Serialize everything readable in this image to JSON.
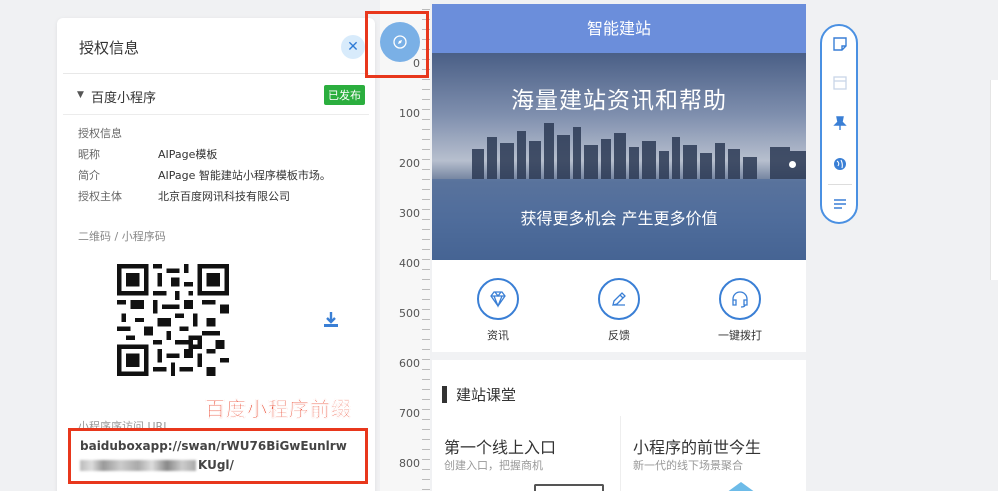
{
  "auth_panel": {
    "title": "授权信息",
    "close_icon": "close-icon",
    "section": {
      "name": "百度小程序",
      "badge": "已发布"
    },
    "info_heading": "授权信息",
    "fields": [
      {
        "label": "昵称",
        "value": "AIPage模板"
      },
      {
        "label": "简介",
        "value": "AIPage 智能建站小程序模板市场。"
      },
      {
        "label": "授权主体",
        "value": "北京百度网讯科技有限公司"
      }
    ],
    "qr_label": "二维码 / 小程序码",
    "download_icon": "download-icon",
    "url_label": "小程序序访问 URL",
    "url_line1": "baiduboxapp://swan/rWU76BiGwEunlrw",
    "url_line2_suffix": "KUgl/"
  },
  "annotation": "百度小程序前缀",
  "ruler": {
    "marks": [
      "0",
      "100",
      "200",
      "300",
      "400",
      "500",
      "600",
      "700",
      "800"
    ]
  },
  "nav_button_icon": "compass-icon",
  "phone": {
    "header": "智能建站",
    "banner": {
      "title": "海量建站资讯和帮助",
      "subtitle": "获得更多机会 产生更多价值"
    },
    "icons": [
      {
        "label": "资讯",
        "icon": "diamond-icon"
      },
      {
        "label": "反馈",
        "icon": "edit-icon"
      },
      {
        "label": "一键拨打",
        "icon": "headset-icon"
      }
    ],
    "section_title": "建站课堂",
    "cards": [
      {
        "title": "第一个线上入口",
        "subtitle": "创建入口，把握商机"
      },
      {
        "title": "小程序的前世今生",
        "subtitle": "新一代的线下场景聚合"
      }
    ]
  },
  "toolbar": {
    "tools": [
      "note-icon",
      "layout-icon",
      "pin-icon",
      "globe-icon",
      "list-icon"
    ]
  },
  "colors": {
    "accent": "#6b8edb",
    "annotation_red": "#e8371c",
    "published_green": "#2bae3e",
    "toolbar_border": "#4a90e2"
  }
}
